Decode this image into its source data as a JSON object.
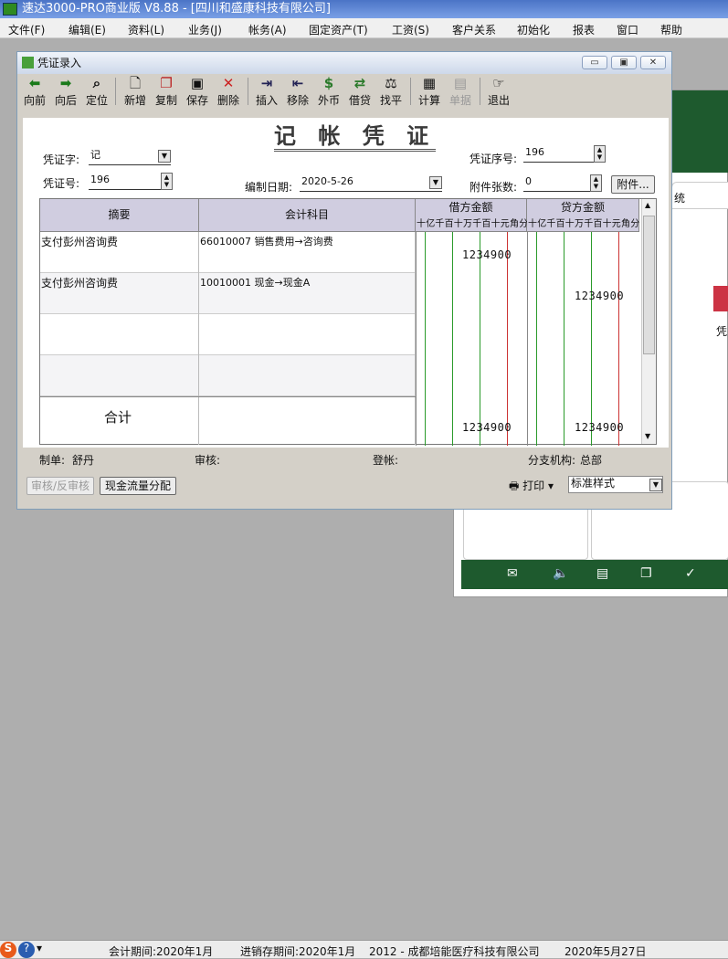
{
  "app": {
    "title": "速达3000-PRO商业版 V8.88 - [四川和盛康科技有限公司]"
  },
  "menu": [
    "文件(F)",
    "编辑(E)",
    "资料(L)",
    "业务(J)",
    "帐务(A)",
    "固定资产(T)",
    "工资(S)",
    "客户关系",
    "初始化",
    "报表",
    "窗口",
    "帮助"
  ],
  "window": {
    "title": "凭证录入",
    "min": "▭",
    "max": "▣",
    "close": "✕"
  },
  "toolbar": {
    "prev": "向前",
    "next": "向后",
    "locate": "定位",
    "add": "新增",
    "copy": "复制",
    "save": "保存",
    "delete": "删除",
    "insert": "插入",
    "remove": "移除",
    "fx": "外币",
    "debit_credit": "借贷",
    "balance": "找平",
    "calc": "计算",
    "doc": "单据",
    "exit": "退出"
  },
  "voucher": {
    "heading": "记 帐 凭 证",
    "type_label": "凭证字:",
    "type_value": "记",
    "seq_label": "凭证序号:",
    "seq_value": "196",
    "no_label": "凭证号:",
    "no_value": "196",
    "date_label": "编制日期:",
    "date_value": "2020-5-26",
    "attach_label": "附件张数:",
    "attach_value": "0",
    "attach_button": "附件..."
  },
  "grid": {
    "headers": {
      "summary": "摘要",
      "account": "会计科目",
      "debit": "借方金额",
      "credit": "贷方金额"
    },
    "digits": "十亿千百十万千百十元角分",
    "rows": [
      {
        "summary": "支付彭州咨询费",
        "account": "66010007 销售费用→咨询费",
        "debit": "1234900",
        "credit": ""
      },
      {
        "summary": "支付彭州咨询费",
        "account": "10010001 现金→现金A",
        "debit": "",
        "credit": "1234900"
      },
      {
        "summary": "",
        "account": "",
        "debit": "",
        "credit": ""
      },
      {
        "summary": "",
        "account": "",
        "debit": "",
        "credit": ""
      }
    ],
    "total_label": "合计",
    "total_debit": "1234900",
    "total_credit": "1234900"
  },
  "footer": {
    "maker_label": "制单:",
    "maker_value": "舒丹",
    "audit_label": "审核:",
    "post_label": "登帐:",
    "branch_label": "分支机构:",
    "branch_value": "总部"
  },
  "actions": {
    "audit": "审核/反审核",
    "cashflow": "现金流量分配",
    "print": "打印",
    "style": "标准样式"
  },
  "background": {
    "tab_text": "统",
    "side_text": "凭"
  },
  "statusbar": {
    "period": "会计期间:2020年1月",
    "inventory": "进销存期间:2020年1月",
    "company": "2012 - 成都培能医疗科技有限公司",
    "date": "2020年5月27日"
  }
}
